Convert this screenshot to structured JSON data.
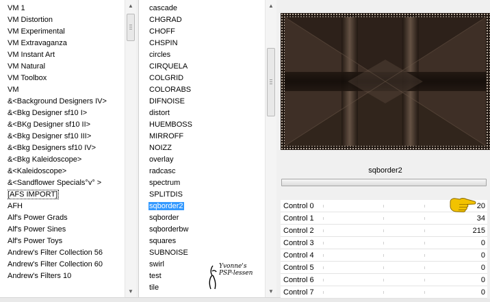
{
  "categories": {
    "items": [
      "VM 1",
      "VM Distortion",
      "VM Experimental",
      "VM Extravaganza",
      "VM Instant Art",
      "VM Natural",
      "VM Toolbox",
      "VM",
      "&<Background Designers IV>",
      "&<Bkg Designer sf10 I>",
      "&<BKg Designer sf10 II>",
      "&<Bkg Designer sf10 III>",
      "&<Bkg Designers sf10 IV>",
      "&<Bkg Kaleidoscope>",
      "&<Kaleidoscope>",
      "&<Sandflower Specials°v° >",
      "[AFS IMPORT]",
      "AFH",
      "Alf's Power Grads",
      "Alf's Power Sines",
      "Alf's Power Toys",
      "Andrew's Filter Collection 56",
      "Andrew's Filter Collection 60",
      "Andrew's Filters 10"
    ],
    "boxed_index": 16
  },
  "filters": {
    "items": [
      "cascade",
      "CHGRAD",
      "CHOFF",
      "CHSPIN",
      "circles",
      "CIRQUELA",
      "COLGRID",
      "COLORABS",
      "DIFNOISE",
      "distort",
      "HUEMBOSS",
      "MIRROFF",
      "NOIZZ",
      "overlay",
      "radcasc",
      "spectrum",
      "SPLITDIS",
      "sqborder2",
      "sqborder",
      "sqborderbw",
      "squares",
      "SUBNOISE",
      "swirl",
      "test",
      "tile"
    ],
    "selected_index": 17
  },
  "preview": {
    "filter_name": "sqborder2",
    "colors": {
      "base": "#3e2f26",
      "dark": "#1f1610",
      "light": "#6e5a4b",
      "border": "#c9bcae"
    }
  },
  "controls": [
    {
      "label": "Control 0",
      "value": "20"
    },
    {
      "label": "Control 1",
      "value": "34"
    },
    {
      "label": "Control 2",
      "value": "215"
    },
    {
      "label": "Control 3",
      "value": "0"
    },
    {
      "label": "Control 4",
      "value": "0"
    },
    {
      "label": "Control 5",
      "value": "0"
    },
    {
      "label": "Control 6",
      "value": "0"
    },
    {
      "label": "Control 7",
      "value": "0"
    }
  ],
  "watermark": {
    "line1": "Yvonne's",
    "line2": "PSP-lessen"
  },
  "colors": {
    "selection": "#3399ff",
    "pointer": "#f2c200"
  }
}
